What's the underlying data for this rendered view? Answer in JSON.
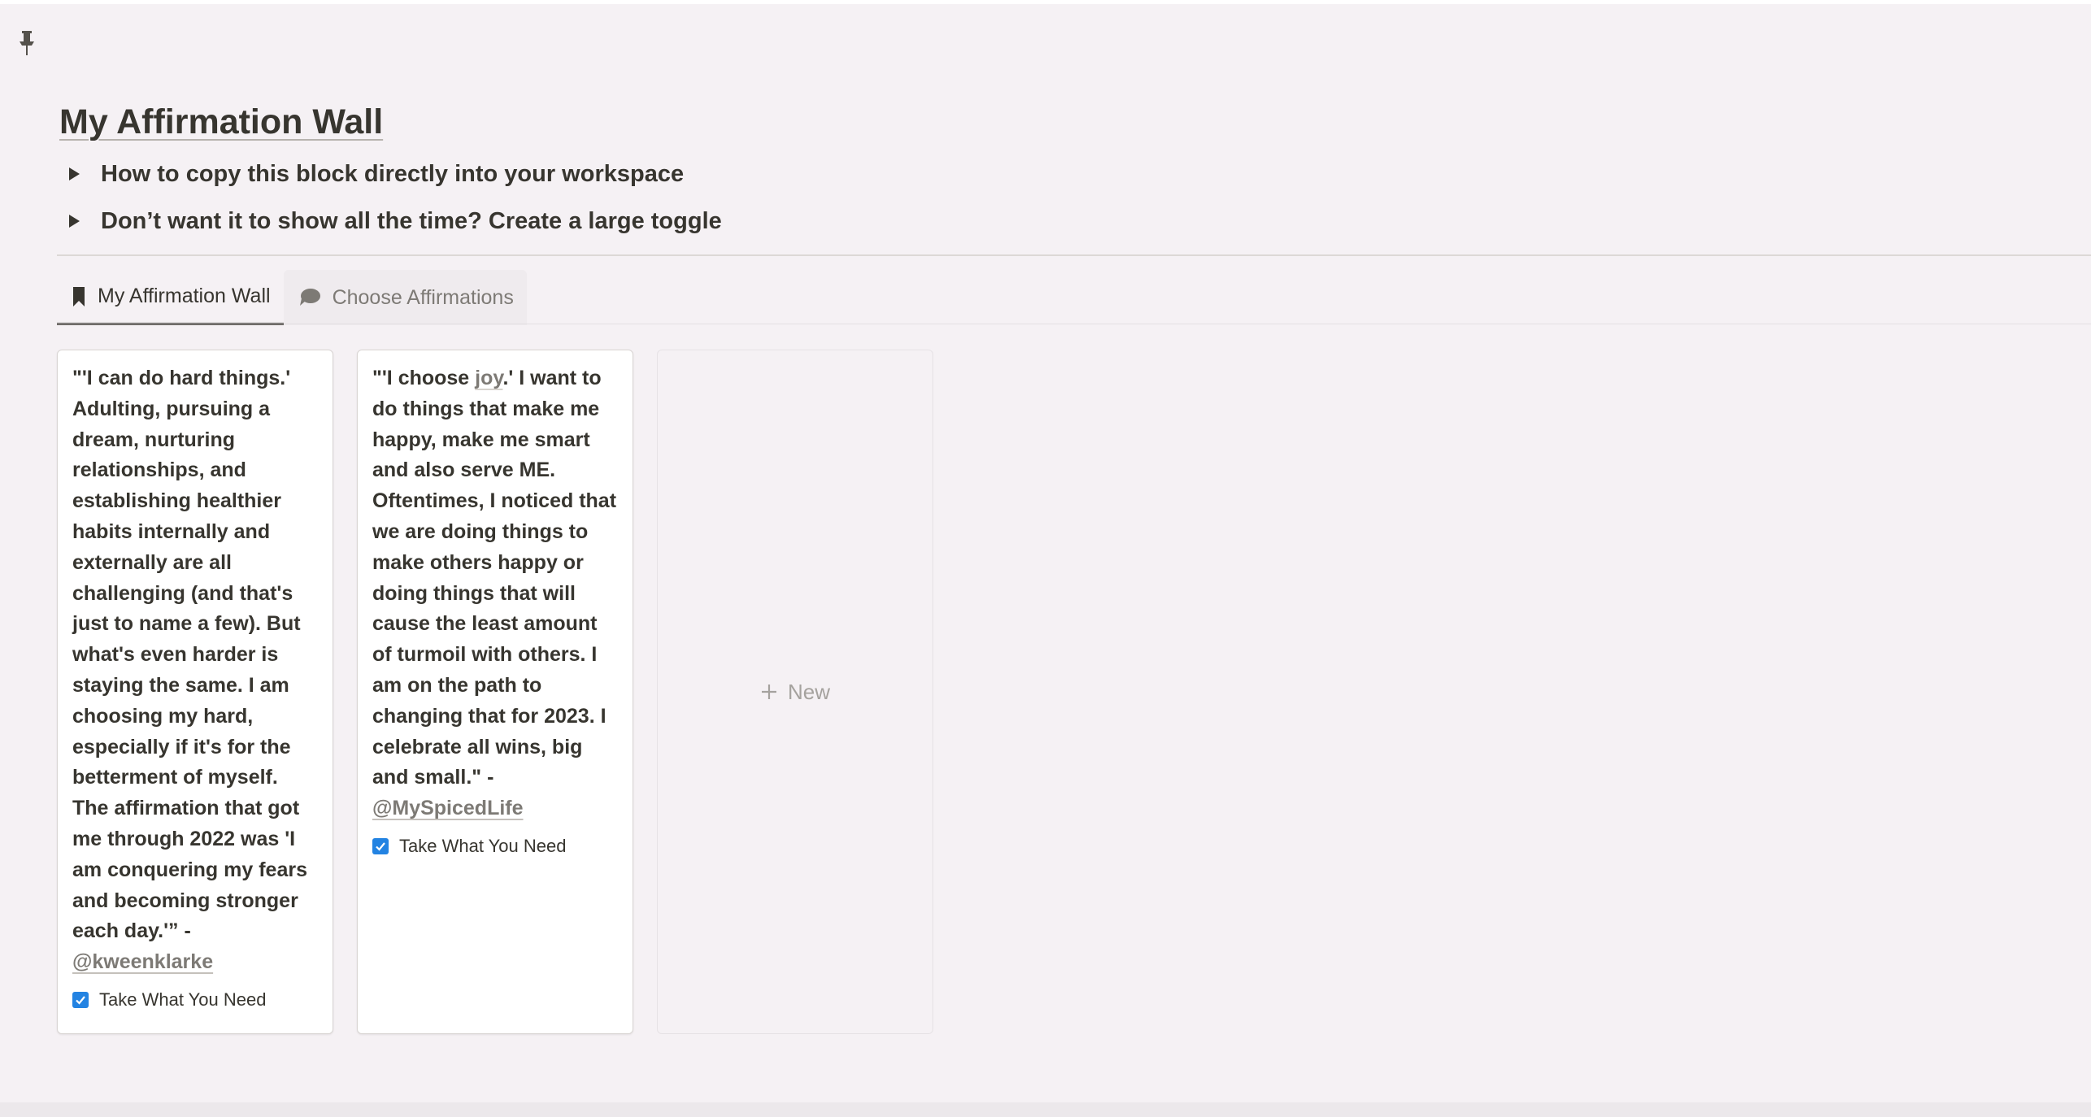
{
  "page": {
    "title": "My Affirmation Wall"
  },
  "toggles": [
    {
      "label": "How to copy this block directly into your workspace"
    },
    {
      "label": "Don’t want it to show all the time? Create a large toggle"
    }
  ],
  "tabs": [
    {
      "label": "My Affirmation Wall",
      "icon": "bookmark-icon",
      "active": true
    },
    {
      "label": "Choose Affirmations",
      "icon": "speech-bubble-icon",
      "active": false
    }
  ],
  "cards": [
    {
      "text": "\"'I can do hard things.' Adulting, pursuing a dream, nurturing relationships, and establishing healthier habits internally and externally are all challenging (and that's just to name a few). But what's even harder is staying the same. I am choosing my hard, especially if it's for the betterment of myself. The affirmation that got me through 2022 was 'I am conquering my fears and becoming stronger each day.'” - ",
      "mention": "@kweenklarke",
      "tag": "Take What You Need",
      "checked": true
    },
    {
      "text_before": "\"'I choose ",
      "link": "joy",
      "text_after": ".' I want to do things that make me happy, make me smart and also serve ME. Oftentimes, I noticed that we are doing things to make others happy or doing things that will cause the least amount of turmoil with others. I am on the path to changing that for 2023. I celebrate all wins, big and small.\" - ",
      "mention": "@MySpicedLife",
      "tag": "Take What You Need",
      "checked": true
    }
  ],
  "new_card": {
    "label": "New",
    "icon": "plus-icon"
  },
  "colors": {
    "background": "#f5f1f4",
    "text": "#37352f",
    "muted": "#7d7a75",
    "checkbox": "#2383e2"
  }
}
